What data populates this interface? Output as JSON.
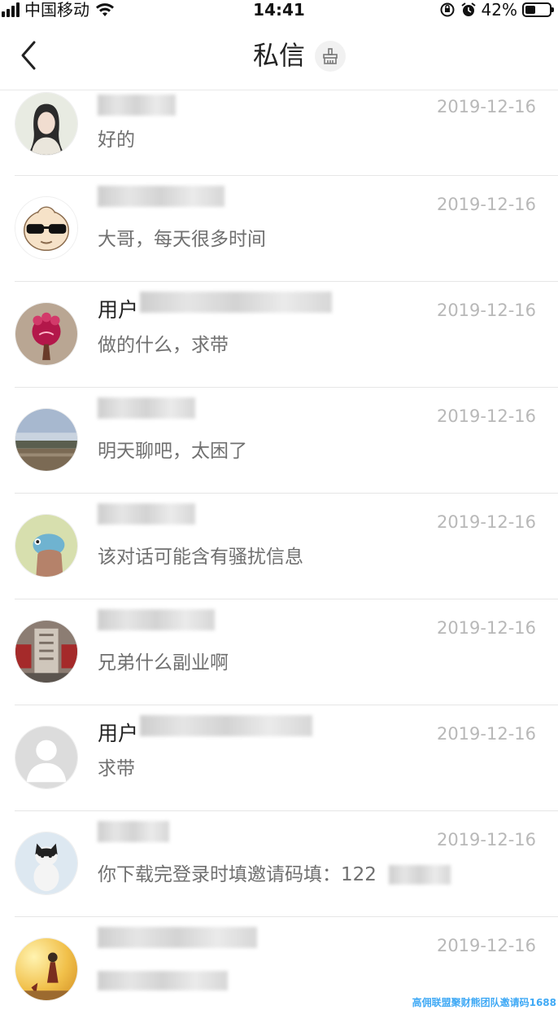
{
  "status_bar": {
    "carrier": "中国移动",
    "time": "14:41",
    "battery_percent": "42%",
    "battery_level": 0.42
  },
  "nav": {
    "title": "私信",
    "back_icon": "chevron-left-icon",
    "clean_icon": "broom-icon"
  },
  "conversations": [
    {
      "name": "",
      "message": "好的",
      "date": "2019-12-16",
      "avatar": "woman-portrait"
    },
    {
      "name": "",
      "message": "大哥，每天很多时间",
      "date": "2019-12-16",
      "avatar": "cartoon-sunglasses"
    },
    {
      "name": "用户",
      "message": "做的什么，求带",
      "date": "2019-12-16",
      "avatar": "pink-flower"
    },
    {
      "name": "",
      "message": "明天聊吧，太困了",
      "date": "2019-12-16",
      "avatar": "landscape"
    },
    {
      "name": "",
      "message": "该对话可能含有骚扰信息",
      "date": "2019-12-16",
      "avatar": "green-figure"
    },
    {
      "name": "",
      "message": "兄弟什么副业啊",
      "date": "2019-12-16",
      "avatar": "temple-stone"
    },
    {
      "name": "用户",
      "message": "求带",
      "date": "2019-12-16",
      "avatar": "default-user"
    },
    {
      "name": "",
      "message": "你下载完登录时填邀请码填：122",
      "date": "2019-12-16",
      "avatar": "cat"
    },
    {
      "name": "",
      "message": "",
      "date": "2019-12-16",
      "avatar": "sunset-figure"
    }
  ],
  "watermark": "高佣联盟聚财熊团队邀请码1688"
}
